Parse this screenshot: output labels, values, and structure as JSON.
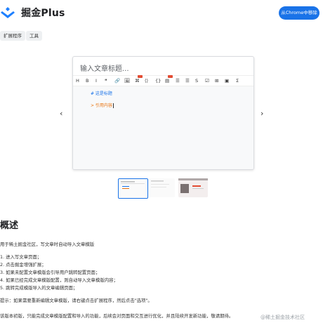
{
  "header": {
    "app_name": "掘金Plus",
    "remove_button": "从Chrome中移除"
  },
  "chips": [
    "扩展程序",
    "工具"
  ],
  "carousel": {
    "prev_arrow": "‹",
    "next_arrow": "›",
    "editor": {
      "title_placeholder": "输入文章标题...",
      "toolbar": [
        "H",
        "B",
        "I",
        "❝",
        "🔗",
        "🖼",
        "⌘",
        "⟨⟩",
        "{}",
        "▤",
        "☰",
        "☰",
        "S",
        "☑",
        "⊞",
        "▣",
        "Σ"
      ],
      "lines": {
        "heading": "#  这是标题",
        "quote": ">  引用内容"
      }
    },
    "thumbnails": [
      "thumb-1",
      "thumb-2",
      "thumb-3"
    ],
    "active_thumbnail": 0
  },
  "overview": {
    "heading": "概述",
    "intro": "用于稀土掘金社区，写文章时自动导入文章模版",
    "steps": [
      "1. 进入写文章页面；",
      "2. 点击掘金增强扩展；",
      "3. 如果未配置文章模版会引导用户跳转配置页面；",
      "4. 如果已经完成文章模版配置，则自动导入文章模版内容；",
      "5. 跳转完成模版导入的文章编辑页面；"
    ],
    "tip": "提示：如果需要重新编辑文章模版，请右键点击扩展程序，然后点击\"选项\"。",
    "footer": "该版本初版，只能完成文章模版配置和导入的功能，后续会对页面和交互进行优化，并且陆续开发新功能，敬请期待。"
  },
  "watermark": "@稀土掘金技术社区",
  "colors": {
    "accent": "#1a73e8",
    "heading_line": "#1a73e8",
    "quote_line": "#e8710a"
  }
}
